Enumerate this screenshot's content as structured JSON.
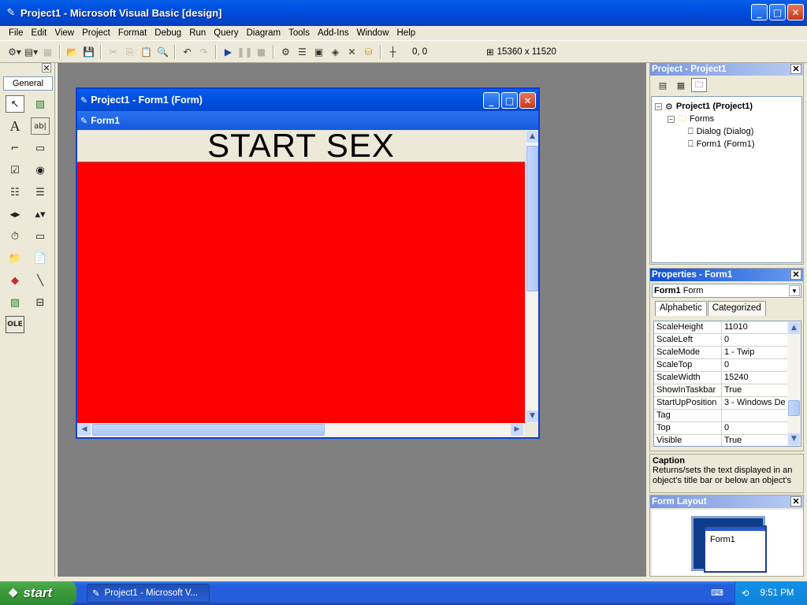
{
  "window": {
    "title": "Project1 - Microsoft Visual Basic [design]",
    "icon": "vb-ide-icon",
    "minimize": "_",
    "maximize": "□",
    "close": "✕"
  },
  "menu": [
    "File",
    "Edit",
    "View",
    "Project",
    "Format",
    "Debug",
    "Run",
    "Query",
    "Diagram",
    "Tools",
    "Add-Ins",
    "Window",
    "Help"
  ],
  "toolbar": {
    "position": "0, 0",
    "size": "15360 x 11520"
  },
  "toolbox": {
    "tab_label": "General",
    "close": "✕"
  },
  "form_window": {
    "title": "Project1 - Form1 (Form)",
    "inner_title": "Form1",
    "label_caption": "START SEX",
    "back_color": "#ff0000"
  },
  "project_panel": {
    "title": "Project - Project1",
    "close": "✕",
    "tree": {
      "root": "Project1 (Project1)",
      "folder": "Forms",
      "items": [
        "Dialog (Dialog)",
        "Form1 (Form1)"
      ]
    }
  },
  "properties_panel": {
    "title": "Properties - Form1",
    "close": "✕",
    "object_name": "Form1",
    "object_type": "Form",
    "tabs": [
      "Alphabetic",
      "Categorized"
    ],
    "rows": [
      {
        "name": "ScaleHeight",
        "value": "11010"
      },
      {
        "name": "ScaleLeft",
        "value": "0"
      },
      {
        "name": "ScaleMode",
        "value": "1 - Twip"
      },
      {
        "name": "ScaleTop",
        "value": "0"
      },
      {
        "name": "ScaleWidth",
        "value": "15240"
      },
      {
        "name": "ShowInTaskbar",
        "value": "True"
      },
      {
        "name": "StartUpPosition",
        "value": "3 - Windows Def"
      },
      {
        "name": "Tag",
        "value": ""
      },
      {
        "name": "Top",
        "value": "0"
      },
      {
        "name": "Visible",
        "value": "True"
      }
    ]
  },
  "description": {
    "title": "Caption",
    "text": "Returns/sets the text displayed in an object's title bar or below an object's"
  },
  "form_layout": {
    "title": "Form Layout",
    "close": "✕",
    "form_label": "Form1"
  },
  "taskbar": {
    "start": "start",
    "task": "Project1 - Microsoft V...",
    "clock": "9:51 PM"
  }
}
